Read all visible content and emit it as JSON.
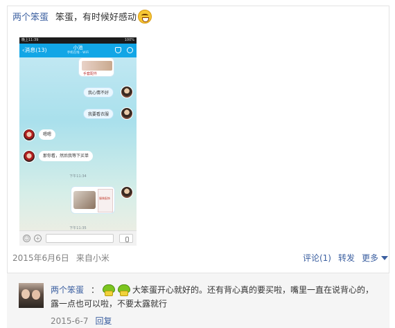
{
  "post": {
    "author": "两个笨蛋",
    "text": "笨蛋，有时候好感动",
    "emoji": "crying-laugh-emoji",
    "date": "2015年6月6日",
    "source": "来自小米",
    "actions": {
      "comment": "评论(1)",
      "repost": "转发",
      "more": "更多"
    }
  },
  "phone": {
    "status_time": "晚上11:39",
    "status_right": "100%",
    "back_label": "消息(13)",
    "contact_name": "小池",
    "contact_status": "手机在线 - WiFi",
    "messages": [
      {
        "from": "me",
        "text": "我心情不好"
      },
      {
        "from": "me",
        "text": "我要看衣服"
      },
      {
        "from": "them",
        "text": "嗯嗯"
      },
      {
        "from": "them",
        "text": "那你看，然后我等下买单"
      }
    ],
    "timestamp1": "下午11:34",
    "timestamp2": "下午11:35",
    "card_label": "服装配饰",
    "top_card_label": "手套配件"
  },
  "comment": {
    "author": "两个笨蛋",
    "colon": "：",
    "text": "大笨蛋开心就好的。还有背心真的要买啦，嘴里一直在说背心的，露一点也可以啦，不要太露就行",
    "date": "2015-6-7",
    "reply": "回复"
  },
  "colors": {
    "link": "#3b5fa0",
    "meta": "#808080",
    "nav": "#12a6e6"
  }
}
